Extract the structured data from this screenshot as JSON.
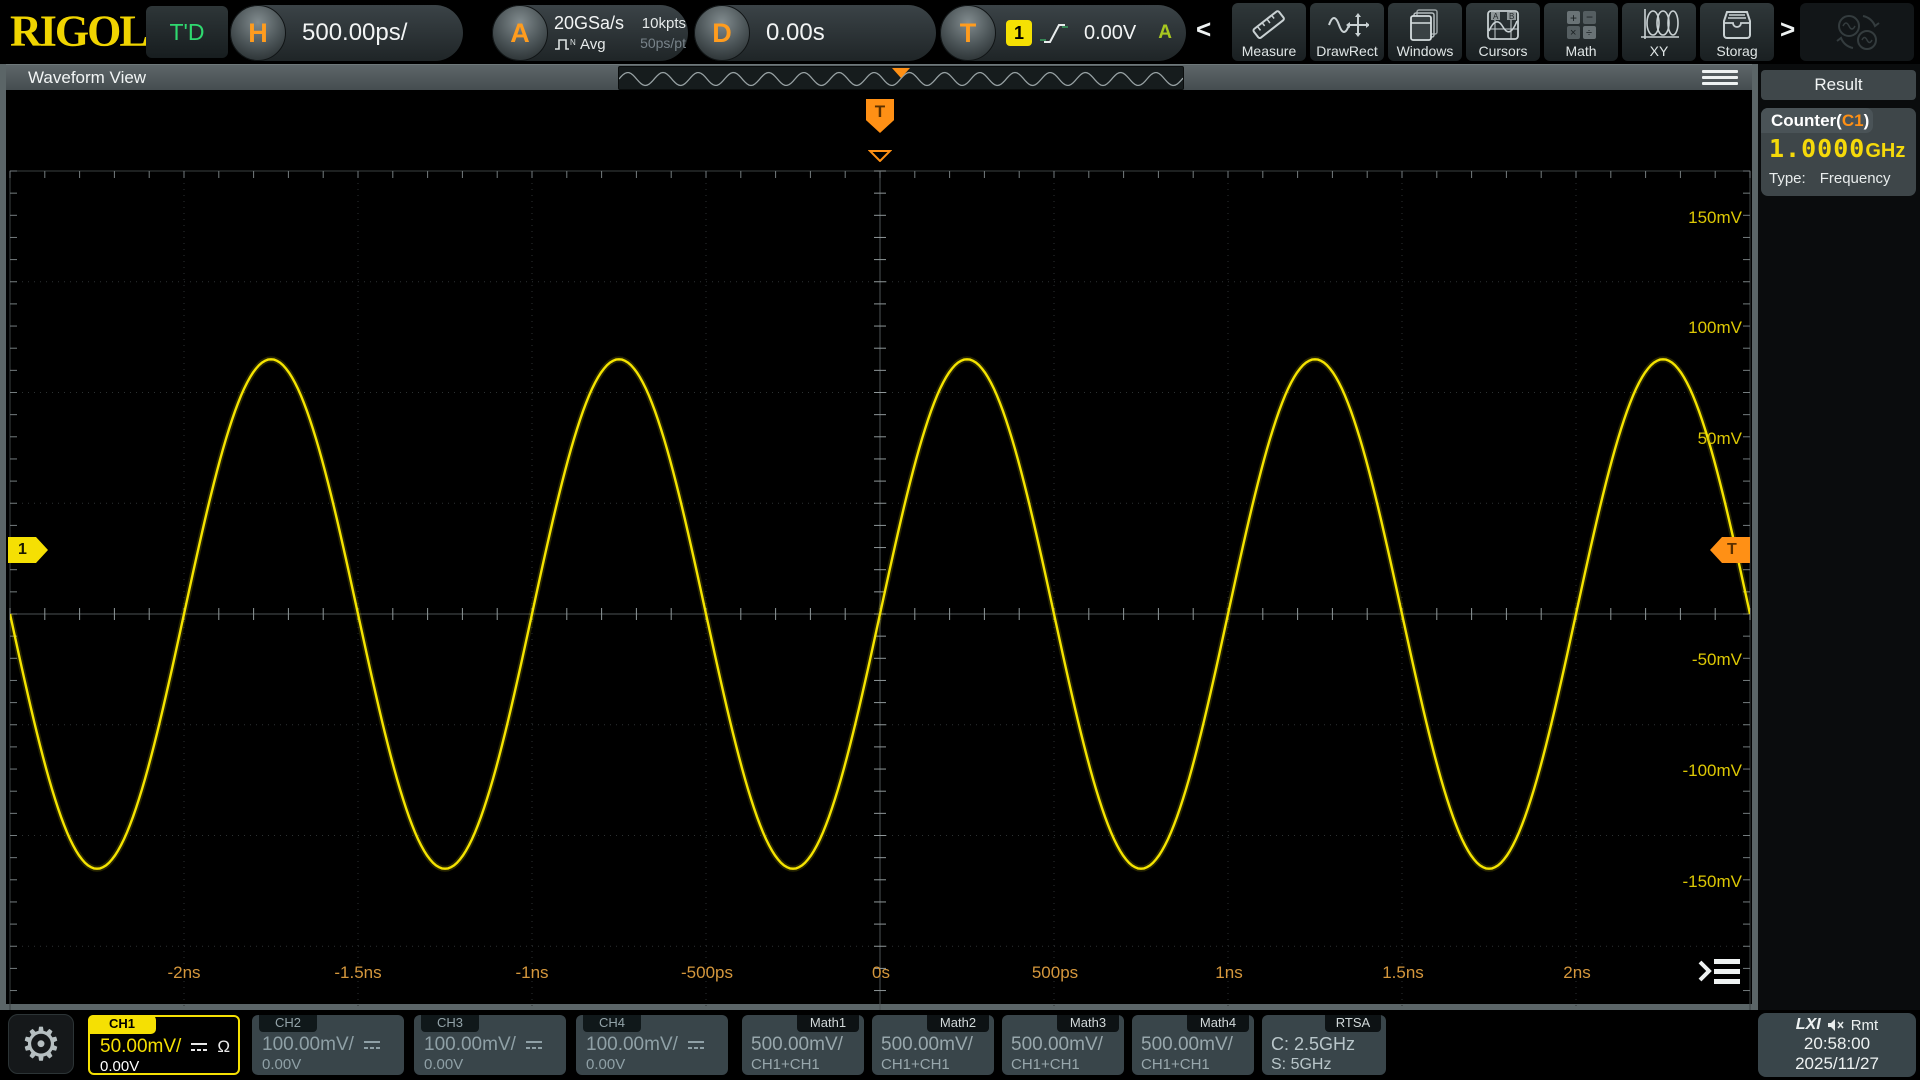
{
  "header": {
    "logo": "RIGOL",
    "trigger_status": "T'D",
    "h_knob": "H",
    "h_scale": "500.00ps/",
    "a_knob": "A",
    "sample_rate": "20GSa/s",
    "acq_mode": "Avg",
    "mem_depth": "10kpts",
    "sample_interval": "50ps/pt",
    "d_knob": "D",
    "h_offset": "0.00s",
    "t_knob": "T",
    "trig_source": "1",
    "trig_level": "0.00V",
    "trig_sweep": "A",
    "scroll_left": "<",
    "scroll_right": ">",
    "tools": [
      {
        "label": "Measure",
        "icon": "measure-icon"
      },
      {
        "label": "DrawRect",
        "icon": "drawrect-icon"
      },
      {
        "label": "Windows",
        "icon": "windows-icon"
      },
      {
        "label": "Cursors",
        "icon": "cursors-icon"
      },
      {
        "label": "Math",
        "icon": "math-icon"
      },
      {
        "label": "XY",
        "icon": "xy-icon"
      },
      {
        "label": "Storag",
        "icon": "storage-icon"
      }
    ],
    "sync_icon": "waveform-sync-icon"
  },
  "waveform_view": {
    "title": "Waveform View",
    "channel_marker": "1",
    "trigger_marker": "T",
    "y_labels": [
      "150mV",
      "100mV",
      "50mV",
      "-50mV",
      "-100mV",
      "-150mV"
    ],
    "x_labels": [
      "-2ns",
      "-1.5ns",
      "-1ns",
      "-500ps",
      "0s",
      "500ps",
      "1ns",
      "1.5ns",
      "2ns"
    ]
  },
  "chart_data": {
    "type": "line",
    "signal": "sine",
    "title": "CH1 waveform",
    "frequency": "1GHz",
    "period_ps": 1000,
    "amplitude_mv": 115,
    "offset_mv": 0,
    "volts_per_div_mv": 50,
    "time_per_div_ps": 500,
    "x_range_ps": [
      -2500,
      2500
    ],
    "y_range_mv": [
      -200,
      200
    ],
    "trigger": {
      "level_mv": 0,
      "position_ps": 0,
      "slope": "rising"
    },
    "x_tick_labels": [
      "-2ns",
      "-1.5ns",
      "-1ns",
      "-500ps",
      "0s",
      "500ps",
      "1ns",
      "1.5ns",
      "2ns"
    ],
    "y_tick_labels": [
      "150mV",
      "100mV",
      "50mV",
      "-50mV",
      "-100mV",
      "-150mV"
    ],
    "grid": "dotted 10x8 divisions, center crosshair with minor ticks",
    "trace_color": "#f5e400"
  },
  "result_panel": {
    "title": "Result",
    "counter_prefix": "Counter(",
    "counter_source": "C1",
    "counter_suffix": ")",
    "counter_value": "1.0000",
    "counter_unit": "GHz",
    "type_label": "Type:",
    "type_value": "Frequency"
  },
  "channels": [
    {
      "id": "CH1",
      "scale": "50.00mV/",
      "offset": "0.00V",
      "impedance": "Ω",
      "active": true
    },
    {
      "id": "CH2",
      "scale": "100.00mV/",
      "offset": "0.00V"
    },
    {
      "id": "CH3",
      "scale": "100.00mV/",
      "offset": "0.00V"
    },
    {
      "id": "CH4",
      "scale": "100.00mV/",
      "offset": "0.00V"
    }
  ],
  "math": [
    {
      "id": "Math1",
      "scale": "500.00mV/",
      "expr": "CH1+CH1"
    },
    {
      "id": "Math2",
      "scale": "500.00mV/",
      "expr": "CH1+CH1"
    },
    {
      "id": "Math3",
      "scale": "500.00mV/",
      "expr": "CH1+CH1"
    },
    {
      "id": "Math4",
      "scale": "500.00mV/",
      "expr": "CH1+CH1"
    }
  ],
  "rtsa": {
    "id": "RTSA",
    "center": "C: 2.5GHz",
    "span": "S: 5GHz"
  },
  "status": {
    "lxi": "LXI",
    "mute_icon": "speaker-muted-icon",
    "remote": "Rmt",
    "time": "20:58:00",
    "date": "2025/11/27"
  },
  "icons": {
    "measure-icon": "ruler",
    "drawrect-icon": "sine+move-cross",
    "windows-icon": "stacked-windows",
    "cursors-icon": "graticule-ab",
    "math-icon": "plus-minus-times-divide",
    "xy-icon": "lissajous",
    "storage-icon": "storage-drawer",
    "waveform-sync-icon": "circular-arrows",
    "gear-icon": "gear",
    "hamburger-icon": "menu-bars",
    "grid-menu-icon": "chevron-menu-bars",
    "avg-icon": "pulse-N",
    "slope-icon": "rising-edge",
    "coupling-icon": "dc-coupling"
  }
}
